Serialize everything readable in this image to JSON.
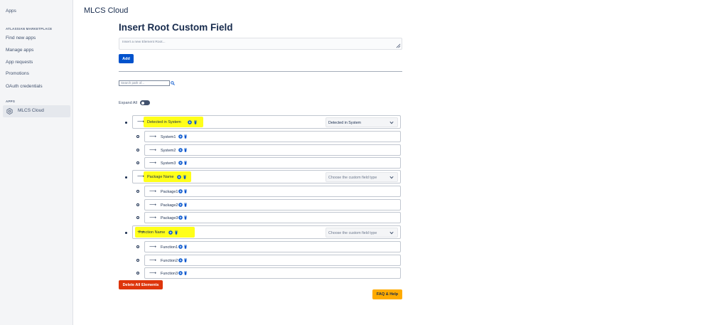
{
  "sidebar": {
    "apps_link": "Apps",
    "marketplace_heading": "ATLASSIAN MARKETPLACE",
    "items": [
      "Find new apps",
      "Manage apps",
      "App requests",
      "Promotions",
      "OAuth credentials"
    ],
    "apps_heading": "APPS",
    "active_app": "MLCS Cloud"
  },
  "header": {
    "app_title": "MLCS Cloud",
    "page_title": "Insert Root Custom Field"
  },
  "form": {
    "root_placeholder": "Insert a new Element Root...",
    "add_label": "Add",
    "search_placeholder": "Search path of...",
    "expand_label": "Expand All",
    "expand_on": false
  },
  "tree": [
    {
      "label": "Detected in System",
      "select_value": "Detected in System",
      "select_is_placeholder": false,
      "children": [
        "System1",
        "System2",
        "System3"
      ]
    },
    {
      "label": "Package Name",
      "select_value": "Choose the custom field type",
      "select_is_placeholder": true,
      "children": [
        "Package1",
        "Package2",
        "Package3"
      ]
    },
    {
      "label": "Function Name",
      "select_value": "Choose the custom field type",
      "select_is_placeholder": true,
      "children": [
        "Function1",
        "Function2",
        "Function3"
      ]
    }
  ],
  "actions": {
    "delete_all": "Delete All Elements",
    "faq": "FAQ & Help"
  },
  "colors": {
    "primary": "#0052cc",
    "danger": "#de350b",
    "warning": "#ffab00",
    "highlight": "#ffff1a"
  }
}
